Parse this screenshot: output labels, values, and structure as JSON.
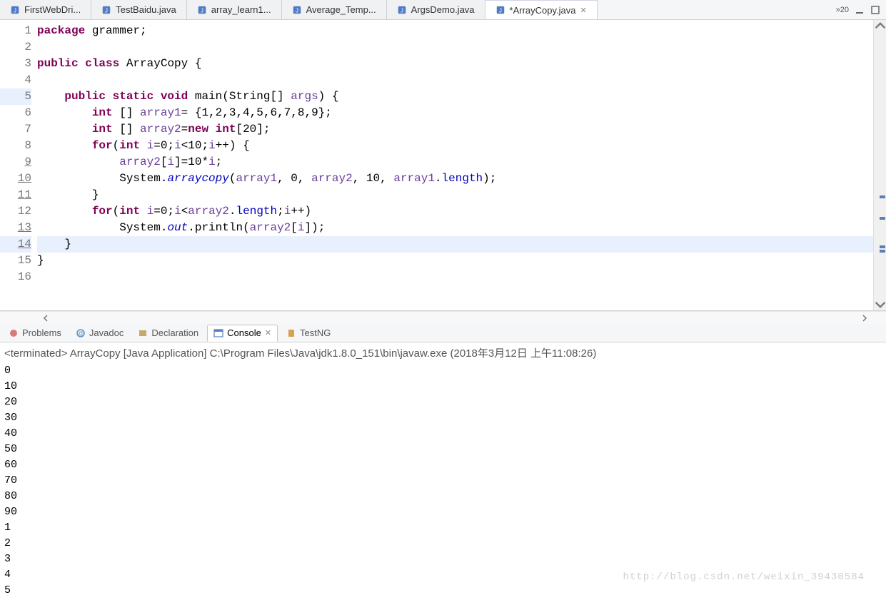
{
  "editorTabs": {
    "items": [
      {
        "label": "FirstWebDri...",
        "icon": "java"
      },
      {
        "label": "TestBaidu.java",
        "icon": "java"
      },
      {
        "label": "array_learn1...",
        "icon": "java"
      },
      {
        "label": "Average_Temp...",
        "icon": "java"
      },
      {
        "label": "ArgsDemo.java",
        "icon": "java"
      },
      {
        "label": "*ArrayCopy.java",
        "icon": "java",
        "active": true
      }
    ],
    "overflow": "»20"
  },
  "code": {
    "lines": [
      {
        "n": "1",
        "segs": [
          [
            "kpkg",
            "package "
          ],
          [
            "kname",
            "grammer;"
          ]
        ]
      },
      {
        "n": "2",
        "segs": []
      },
      {
        "n": "3",
        "segs": [
          [
            "kpkg",
            "public class "
          ],
          [
            "kname",
            "ArrayCopy {"
          ]
        ]
      },
      {
        "n": "4",
        "segs": []
      },
      {
        "n": "5",
        "ovr": true,
        "segs": [
          [
            "kname",
            "    "
          ],
          [
            "kpkg",
            "public static "
          ],
          [
            "ktyp",
            "void"
          ],
          [
            "kname",
            " main(String[] "
          ],
          [
            "karr",
            "args"
          ],
          [
            "kname",
            ") {"
          ]
        ]
      },
      {
        "n": "6",
        "segs": [
          [
            "kname",
            "        "
          ],
          [
            "ktyp",
            "int"
          ],
          [
            "kname",
            " [] "
          ],
          [
            "karr",
            "array1"
          ],
          [
            "kname",
            "= {1,2,3,4,5,6,7,8,9};"
          ]
        ]
      },
      {
        "n": "7",
        "segs": [
          [
            "kname",
            "        "
          ],
          [
            "ktyp",
            "int"
          ],
          [
            "kname",
            " [] "
          ],
          [
            "karr",
            "array2"
          ],
          [
            "kname",
            "="
          ],
          [
            "kpkg",
            "new "
          ],
          [
            "ktyp",
            "int"
          ],
          [
            "kname",
            "[20];"
          ]
        ]
      },
      {
        "n": "8",
        "segs": [
          [
            "kname",
            "        "
          ],
          [
            "kpkg",
            "for"
          ],
          [
            "kname",
            "("
          ],
          [
            "ktyp",
            "int"
          ],
          [
            "kname",
            " "
          ],
          [
            "karr",
            "i"
          ],
          [
            "kname",
            "=0;"
          ],
          [
            "karr",
            "i"
          ],
          [
            "kname",
            "<10;"
          ],
          [
            "karr",
            "i"
          ],
          [
            "kname",
            "++) {"
          ]
        ]
      },
      {
        "n": "9",
        "hl": true,
        "segs": [
          [
            "kname",
            "            "
          ],
          [
            "karr",
            "array2"
          ],
          [
            "kname",
            "["
          ],
          [
            "karr",
            "i"
          ],
          [
            "kname",
            "]=10*"
          ],
          [
            "karr",
            "i"
          ],
          [
            "kname",
            ";"
          ]
        ]
      },
      {
        "n": "10",
        "hl": true,
        "segs": [
          [
            "kname",
            "            System."
          ],
          [
            "kstat",
            "arraycopy"
          ],
          [
            "kname",
            "("
          ],
          [
            "karr",
            "array1"
          ],
          [
            "kname",
            ", 0, "
          ],
          [
            "karr",
            "array2"
          ],
          [
            "kname",
            ", 10, "
          ],
          [
            "karr",
            "array1"
          ],
          [
            "kname",
            "."
          ],
          [
            "kfld",
            "length"
          ],
          [
            "kname",
            ");"
          ]
        ]
      },
      {
        "n": "11",
        "hl": true,
        "segs": [
          [
            "kname",
            "        }"
          ]
        ]
      },
      {
        "n": "12",
        "segs": [
          [
            "kname",
            "        "
          ],
          [
            "kpkg",
            "for"
          ],
          [
            "kname",
            "("
          ],
          [
            "ktyp",
            "int"
          ],
          [
            "kname",
            " "
          ],
          [
            "karr",
            "i"
          ],
          [
            "kname",
            "=0;"
          ],
          [
            "karr",
            "i"
          ],
          [
            "kname",
            "<"
          ],
          [
            "karr",
            "array2"
          ],
          [
            "kname",
            "."
          ],
          [
            "kfld",
            "length"
          ],
          [
            "kname",
            ";"
          ],
          [
            "karr",
            "i"
          ],
          [
            "kname",
            "++)"
          ]
        ]
      },
      {
        "n": "13",
        "hl": true,
        "segs": [
          [
            "kname",
            "            System."
          ],
          [
            "kstat",
            "out"
          ],
          [
            "kname",
            ".println("
          ],
          [
            "karr",
            "array2"
          ],
          [
            "kname",
            "["
          ],
          [
            "karr",
            "i"
          ],
          [
            "kname",
            "]);"
          ]
        ]
      },
      {
        "n": "14",
        "hl": true,
        "curr": true,
        "segs": [
          [
            "kname",
            "    }"
          ]
        ]
      },
      {
        "n": "15",
        "segs": [
          [
            "kname",
            "}"
          ]
        ]
      },
      {
        "n": "16",
        "segs": []
      }
    ]
  },
  "bottomTabs": {
    "items": [
      {
        "label": "Problems",
        "icon": "problems"
      },
      {
        "label": "Javadoc",
        "icon": "javadoc"
      },
      {
        "label": "Declaration",
        "icon": "declaration"
      },
      {
        "label": "Console",
        "icon": "console",
        "active": true
      },
      {
        "label": "TestNG",
        "icon": "testng"
      }
    ]
  },
  "console": {
    "header": "<terminated> ArrayCopy [Java Application] C:\\Program Files\\Java\\jdk1.8.0_151\\bin\\javaw.exe (2018年3月12日 上午11:08:26)",
    "output": [
      "0",
      "10",
      "20",
      "30",
      "40",
      "50",
      "60",
      "70",
      "80",
      "90",
      "1",
      "2",
      "3",
      "4",
      "5"
    ]
  },
  "watermark": "http://blog.csdn.net/weixin_39430584"
}
